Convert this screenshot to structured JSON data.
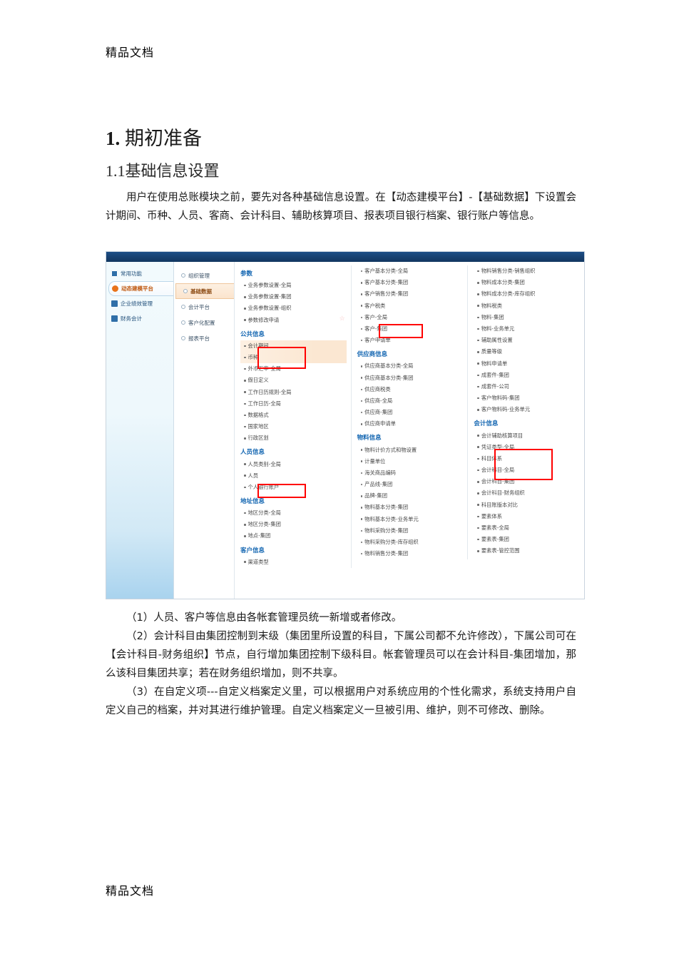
{
  "document": {
    "running_head": "精品文档",
    "running_foot": "精品文档",
    "heading1_num": "1.",
    "heading1_text": "期初准备",
    "heading2": "1.1基础信息设置",
    "intro_paragraph": "用户在使用总账模块之前，要先对各种基础信息设置。在【动态建模平台】-【基础数据】下设置会计期间、币种、人员、客商、会计科目、辅助核算项目、报表项目银行档案、银行账户等信息。",
    "note_1": "（1）人员、客户等信息由各帐套管理员统一新增或者修改。",
    "note_2": "（2）会计科目由集团控制到末级（集团里所设置的科目，下属公司都不允许修改），下属公司可在【会计科目-财务组织】节点，自行增加集团控制下级科目。帐套管理员可以在会计科目-集团增加，那么该科目集团共享；若在财务组织增加，则不共享。",
    "note_3": "（3）在自定义项---自定义档案定义里，可以根据用户对系统应用的个性化需求，系统支持用户自定义自己的档案，并对其进行维护管理。自定义档案定义一旦被引用、维护，则不可修改、删除。"
  },
  "screenshot": {
    "modules": [
      {
        "label": "常用功能",
        "icon": "monitor-icon",
        "active": false
      },
      {
        "label": "动态建模平台",
        "icon": "flower-icon",
        "active": true
      },
      {
        "label": "企业绩效管理",
        "icon": "grid-icon",
        "active": false
      },
      {
        "label": "财务会计",
        "icon": "book-icon",
        "active": false
      }
    ],
    "submodules": [
      {
        "label": "组织管理",
        "active": false
      },
      {
        "label": "基础数据",
        "active": true
      },
      {
        "label": "会计平台",
        "active": false
      },
      {
        "label": "客户化配置",
        "active": false
      },
      {
        "label": "报表平台",
        "active": false
      }
    ],
    "columns": [
      {
        "groups": [
          {
            "title": "参数",
            "links": [
              {
                "label": "业务参数设置-全局",
                "highlight": false,
                "star": false
              },
              {
                "label": "业务参数设置-集团",
                "highlight": false,
                "star": false
              },
              {
                "label": "业务参数设置-组织",
                "highlight": false,
                "star": false
              },
              {
                "label": "参数修改申请",
                "highlight": false,
                "star": true
              }
            ]
          },
          {
            "title": "公共信息",
            "links": [
              {
                "label": "会计期间",
                "highlight": true,
                "star": false
              },
              {
                "label": "币种",
                "highlight": true,
                "star": false
              },
              {
                "label": "外币汇率-全局",
                "highlight": false,
                "star": false
              },
              {
                "label": "假日定义",
                "highlight": false,
                "star": false
              },
              {
                "label": "工作日历规则-全局",
                "highlight": false,
                "star": false
              },
              {
                "label": "工作日历-全局",
                "highlight": false,
                "star": false
              },
              {
                "label": "数据格式",
                "highlight": false,
                "star": false
              },
              {
                "label": "国家地区",
                "highlight": false,
                "star": false
              },
              {
                "label": "行政区划",
                "highlight": false,
                "star": false
              }
            ]
          },
          {
            "title": "人员信息",
            "links": [
              {
                "label": "人员类别-全局",
                "highlight": false,
                "star": false
              },
              {
                "label": "人员",
                "highlight": false,
                "star": false
              },
              {
                "label": "个人银行账户",
                "highlight": false,
                "star": false
              }
            ]
          },
          {
            "title": "地址信息",
            "links": [
              {
                "label": "地区分类-全局",
                "highlight": false,
                "star": false
              },
              {
                "label": "地区分类-集团",
                "highlight": false,
                "star": false
              },
              {
                "label": "地点-集团",
                "highlight": false,
                "star": false
              }
            ]
          },
          {
            "title": "客户信息",
            "links": [
              {
                "label": "渠道类型",
                "highlight": false,
                "star": false
              }
            ]
          }
        ]
      },
      {
        "groups": [
          {
            "title": "",
            "links": [
              {
                "label": "客户基本分类-全局",
                "highlight": false,
                "star": false
              },
              {
                "label": "客户基本分类-集团",
                "highlight": false,
                "star": false
              },
              {
                "label": "客户销售分类-集团",
                "highlight": false,
                "star": false
              },
              {
                "label": "客户税类",
                "highlight": false,
                "star": false
              },
              {
                "label": "客户-全局",
                "highlight": false,
                "star": false
              },
              {
                "label": "客户-集团",
                "highlight": false,
                "star": false
              },
              {
                "label": "客户申请单",
                "highlight": false,
                "star": false
              }
            ]
          },
          {
            "title": "供应商信息",
            "links": [
              {
                "label": "供应商基本分类-全局",
                "highlight": false,
                "star": false
              },
              {
                "label": "供应商基本分类-集团",
                "highlight": false,
                "star": false
              },
              {
                "label": "供应商税类",
                "highlight": false,
                "star": false
              },
              {
                "label": "供应商-全局",
                "highlight": false,
                "star": false
              },
              {
                "label": "供应商-集团",
                "highlight": false,
                "star": false
              },
              {
                "label": "供应商申请单",
                "highlight": false,
                "star": false
              }
            ]
          },
          {
            "title": "物料信息",
            "links": [
              {
                "label": "物料计价方式和物设置",
                "highlight": false,
                "star": false
              },
              {
                "label": "计量单位",
                "highlight": false,
                "star": false
              },
              {
                "label": "海关商品编码",
                "highlight": false,
                "star": false
              },
              {
                "label": "产品线-集团",
                "highlight": false,
                "star": false
              },
              {
                "label": "品牌-集团",
                "highlight": false,
                "star": false
              },
              {
                "label": "物料基本分类-集团",
                "highlight": false,
                "star": false
              },
              {
                "label": "物料基本分类-业务单元",
                "highlight": false,
                "star": false
              },
              {
                "label": "物料采购分类-集团",
                "highlight": false,
                "star": false
              },
              {
                "label": "物料采购分类-库存组织",
                "highlight": false,
                "star": false
              },
              {
                "label": "物料销售分类-集团",
                "highlight": false,
                "star": false
              }
            ]
          }
        ]
      },
      {
        "groups": [
          {
            "title": "",
            "links": [
              {
                "label": "物料销售分类-销售组织",
                "highlight": false,
                "star": false
              },
              {
                "label": "物料成本分类-集团",
                "highlight": false,
                "star": false
              },
              {
                "label": "物料成本分类-库存组织",
                "highlight": false,
                "star": false
              },
              {
                "label": "物料税类",
                "highlight": false,
                "star": false
              },
              {
                "label": "物料-集团",
                "highlight": false,
                "star": false
              },
              {
                "label": "物料-业务单元",
                "highlight": false,
                "star": false
              },
              {
                "label": "辅助属性设置",
                "highlight": false,
                "star": false
              },
              {
                "label": "质量等级",
                "highlight": false,
                "star": false
              },
              {
                "label": "物料申请单",
                "highlight": false,
                "star": false
              },
              {
                "label": "成套件-集团",
                "highlight": false,
                "star": false
              },
              {
                "label": "成套件-公司",
                "highlight": false,
                "star": false
              },
              {
                "label": "客户物料码-集团",
                "highlight": false,
                "star": false
              },
              {
                "label": "客户物料码-业务单元",
                "highlight": false,
                "star": false
              }
            ]
          },
          {
            "title": "会计信息",
            "links": [
              {
                "label": "会计辅助核算项目",
                "highlight": false,
                "star": false
              },
              {
                "label": "凭证类型-全局",
                "highlight": false,
                "star": false
              },
              {
                "label": "科目体系",
                "highlight": false,
                "star": false
              },
              {
                "label": "会计科目-全局",
                "highlight": false,
                "star": false
              },
              {
                "label": "会计科目-集团",
                "highlight": false,
                "star": false
              },
              {
                "label": "会计科目-财务组织",
                "highlight": false,
                "star": false
              },
              {
                "label": "科目账版本对比",
                "highlight": false,
                "star": false
              },
              {
                "label": "要素体系",
                "highlight": false,
                "star": false
              },
              {
                "label": "要素表-全局",
                "highlight": false,
                "star": false
              },
              {
                "label": "要素表-集团",
                "highlight": false,
                "star": false
              },
              {
                "label": "要素表-管控范围",
                "highlight": false,
                "star": false
              }
            ]
          }
        ]
      }
    ],
    "annotations": [
      {
        "name": "redbox-accounting-period-currency",
        "target": "会计期间 / 币种"
      },
      {
        "name": "redbox-person",
        "target": "人员"
      },
      {
        "name": "redbox-customer-group",
        "target": "客户-集团"
      },
      {
        "name": "redbox-account-subject",
        "target": "科目体系 / 会计科目-全局 / 会计科目-集团"
      }
    ],
    "colors": {
      "topbar": "#17406f",
      "group_title": "#1567b2",
      "active_module": "#c05a12",
      "highlight_bg": "#fbe7d2",
      "annotation": "#ff0000",
      "star": "#f8c0c0"
    }
  }
}
